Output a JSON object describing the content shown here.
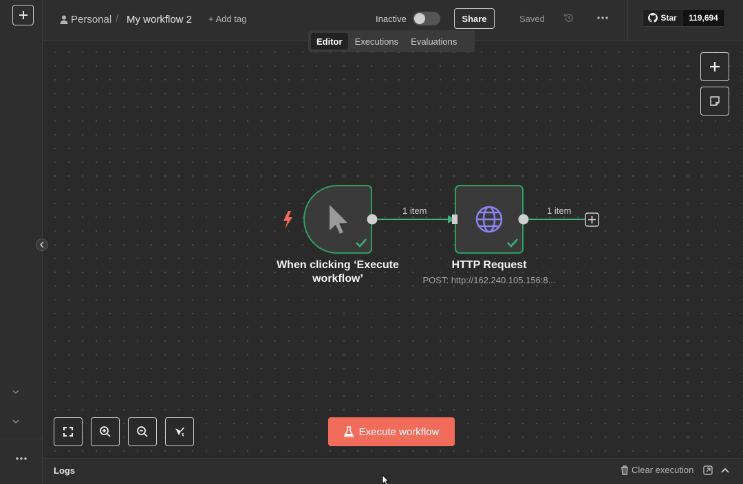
{
  "header": {
    "project": "Personal",
    "separator": "/",
    "workflow_name": "My workflow 2",
    "add_tag": "+ Add tag",
    "status_label": "Inactive",
    "active": false,
    "share_label": "Share",
    "save_state": "Saved",
    "github": {
      "star_label": "Star",
      "star_count": "119,694"
    }
  },
  "tabs": [
    {
      "label": "Editor",
      "active": true
    },
    {
      "label": "Executions",
      "active": false
    },
    {
      "label": "Evaluations",
      "active": false
    }
  ],
  "nodes": [
    {
      "title": "When clicking ‘Execute workflow’",
      "subtitle": "",
      "icon": "cursor-pointer-icon",
      "status": "success"
    },
    {
      "title": "HTTP Request",
      "subtitle": "POST: http://162.240.105.156:8...",
      "icon": "globe-icon",
      "status": "success"
    }
  ],
  "edges": [
    {
      "label": "1 item"
    },
    {
      "label": "1 item"
    }
  ],
  "toolbar": {
    "execute_label": "Execute workflow"
  },
  "logs": {
    "title": "Logs",
    "clear_label": "Clear execution"
  },
  "colors": {
    "accent": "#f26c5b",
    "success": "#3ab37a",
    "node_border": "#2f9e63",
    "globe": "#8b84f0"
  }
}
